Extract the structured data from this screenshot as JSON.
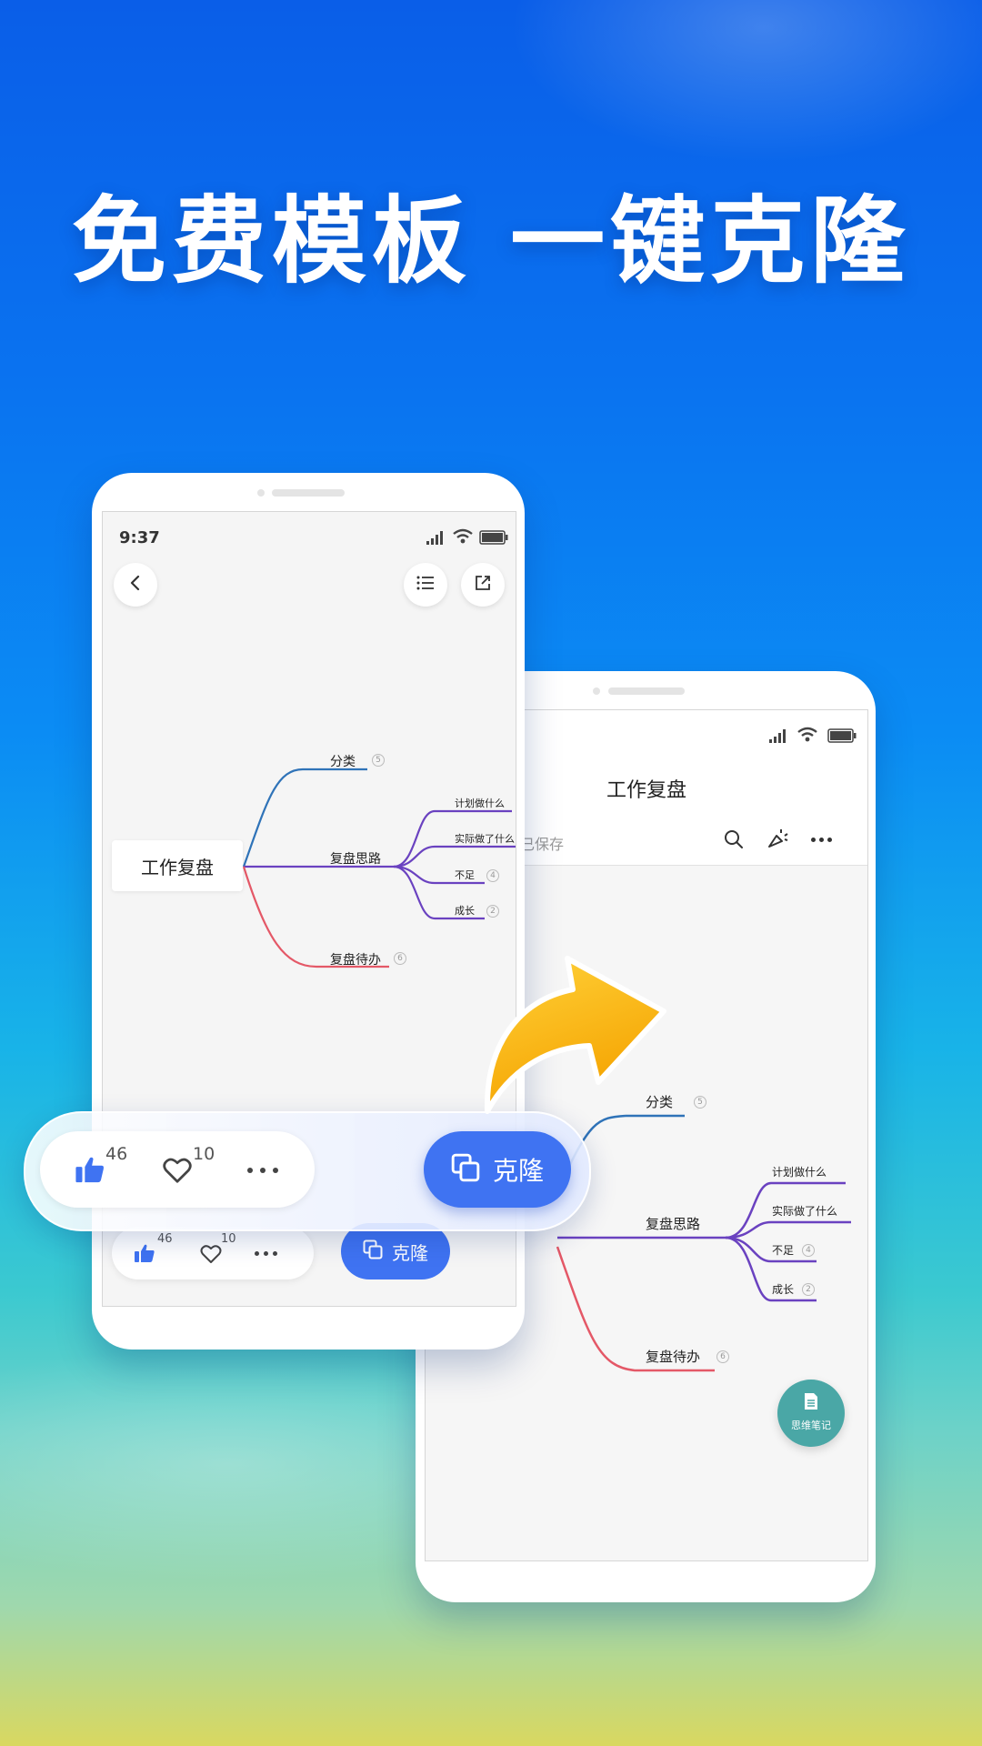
{
  "headline": "免费模板  一键克隆",
  "colors": {
    "accent": "#3f73f2",
    "branch_blue": "#2f73b8",
    "branch_purple": "#6a42c0",
    "branch_red": "#e45867",
    "arrow_top": "#ffd23a",
    "arrow_bottom": "#f5a300",
    "fab": "#4aa7a6"
  },
  "phone_left": {
    "status_time": "9:37",
    "back_icon": "chevron-left-icon",
    "outline_icon": "list-icon",
    "share_icon": "external-link-icon",
    "mindmap": {
      "root": "工作复盘",
      "branches": [
        {
          "label": "分类",
          "count": "5"
        },
        {
          "label": "复盘思路",
          "children": [
            {
              "label": "计划做什么"
            },
            {
              "label": "实际做了什么"
            },
            {
              "label": "不足",
              "count": "4"
            },
            {
              "label": "成长",
              "count": "2"
            }
          ]
        },
        {
          "label": "复盘待办",
          "count": "6"
        }
      ]
    },
    "action_bar": {
      "likes": "46",
      "favorites": "10",
      "clone_label": "克隆"
    }
  },
  "action_popup": {
    "likes": "46",
    "favorites": "10",
    "clone_label": "克隆"
  },
  "phone_right": {
    "title": "工作复盘",
    "save_status": "已保存",
    "mindmap": {
      "branches": [
        {
          "label": "分类",
          "count": "5"
        },
        {
          "label": "复盘思路",
          "children": [
            {
              "label": "计划做什么"
            },
            {
              "label": "实际做了什么"
            },
            {
              "label": "不足",
              "count": "4"
            },
            {
              "label": "成长",
              "count": "2"
            }
          ]
        },
        {
          "label": "复盘待办",
          "count": "6"
        }
      ]
    },
    "fab_label": "思维笔记"
  }
}
